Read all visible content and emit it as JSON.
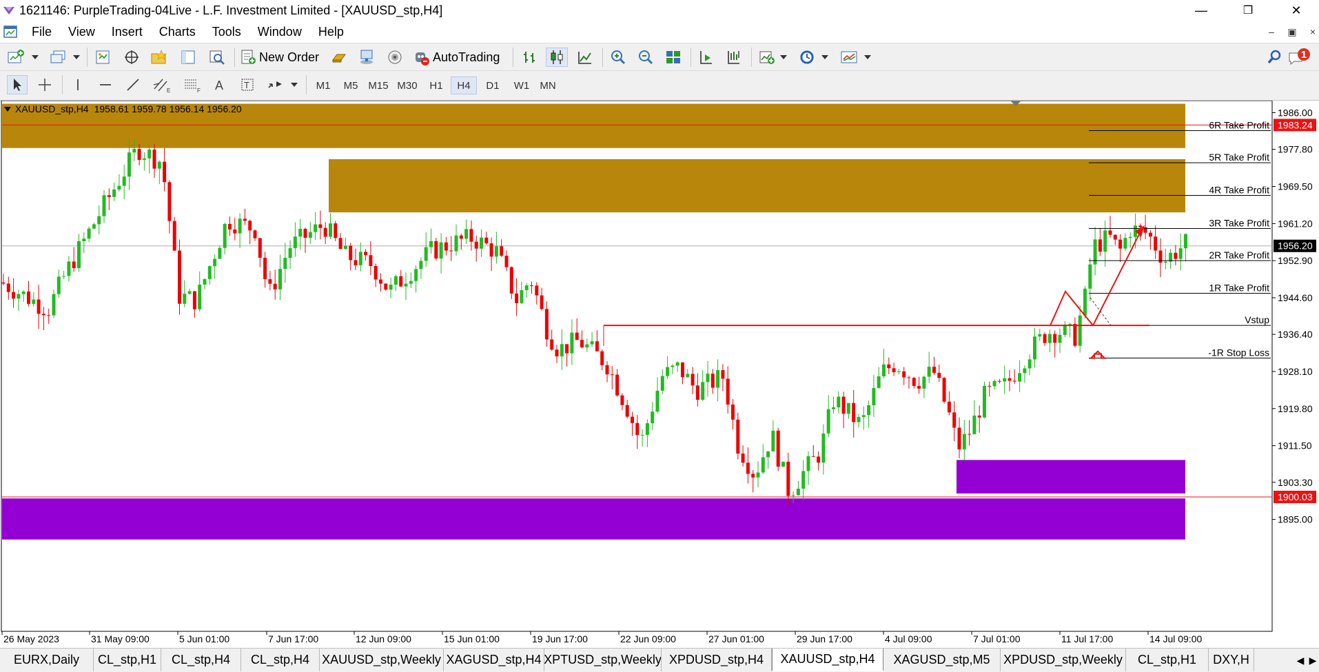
{
  "window": {
    "title": "1621146: PurpleTrading-04Live - L.F. Investment Limited - [XAUUSD_stp,H4]",
    "minimize": "—",
    "maximize": "❐",
    "close": "✕"
  },
  "menu": {
    "items": [
      "File",
      "View",
      "Insert",
      "Charts",
      "Tools",
      "Window",
      "Help"
    ]
  },
  "toolbar": {
    "new_order": "New Order",
    "autotrading": "AutoTrading",
    "notification_count": "1",
    "timeframes": [
      "M1",
      "M5",
      "M15",
      "M30",
      "H1",
      "H4",
      "D1",
      "W1",
      "MN"
    ],
    "active_timeframe": "H4"
  },
  "chart": {
    "symbol": "XAUUSD_stp,H4",
    "ohlc": "1958.61 1959.78 1956.14 1956.20",
    "price_axis": [
      "1986.00",
      "1977.80",
      "1969.50",
      "1961.20",
      "1952.90",
      "1944.60",
      "1936.40",
      "1928.10",
      "1919.80",
      "1911.50",
      "1903.30",
      "1895.00"
    ],
    "price_tags": [
      {
        "label": "1983.24",
        "value": 1983.24,
        "color": "#ee1111"
      },
      {
        "label": "1956.20",
        "value": 1956.2,
        "color": "#000000"
      },
      {
        "label": "1900.03",
        "value": 1900.03,
        "color": "#ee1111"
      }
    ],
    "time_axis": [
      "26 May 2023",
      "31 May 09:00",
      "5 Jun 01:00",
      "7 Jun 17:00",
      "12 Jun 09:00",
      "15 Jun 01:00",
      "19 Jun 17:00",
      "22 Jun 09:00",
      "27 Jun 01:00",
      "29 Jun 17:00",
      "4 Jul 09:00",
      "7 Jul 01:00",
      "11 Jul 17:00",
      "14 Jul 09:00"
    ],
    "levels": [
      {
        "label": "6R Take Profit",
        "price": 1982.0
      },
      {
        "label": "5R Take Profit",
        "price": 1974.8
      },
      {
        "label": "4R Take Profit",
        "price": 1967.5
      },
      {
        "label": "3R Take Profit",
        "price": 1960.1
      },
      {
        "label": "2R Take Profit",
        "price": 1952.9
      },
      {
        "label": "1R Take Profit",
        "price": 1945.6
      },
      {
        "label": "Vstup",
        "price": 1938.4
      },
      {
        "label": "-1R Stop Loss",
        "price": 1931.1
      }
    ],
    "zone_colors": {
      "supply": "#b8860b",
      "demand": "#9400d3"
    },
    "candle_colors": {
      "up": "#22bb22",
      "down": "#ee0000"
    }
  },
  "tabs": {
    "items": [
      "EURX,Daily",
      "CL_stp,H1",
      "CL_stp,H4",
      "CL_stp,H4",
      "XAUUSD_stp,Weekly",
      "XAGUSD_stp,H4",
      "XPTUSD_stp,Weekly",
      "XPDUSD_stp,H4",
      "XAUUSD_stp,H4",
      "XAGUSD_stp,M5",
      "XPDUSD_stp,Weekly",
      "CL_stp,H1",
      "DXY,H"
    ],
    "active": "XAUUSD_stp,H4"
  }
}
